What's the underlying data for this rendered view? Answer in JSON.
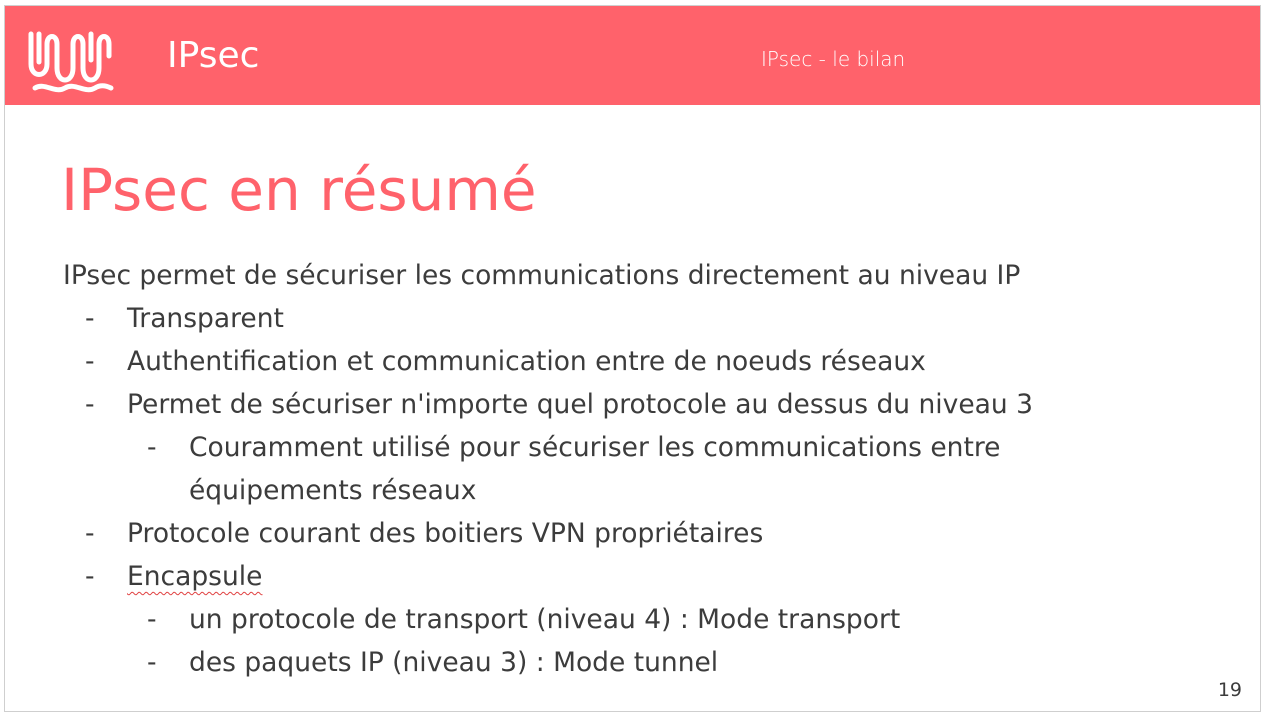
{
  "header": {
    "title": "IPsec",
    "section": "IPsec - le bilan"
  },
  "slide": {
    "title": "IPsec en résumé",
    "intro": "IPsec permet de sécuriser les communications directement au niveau IP",
    "bullets": [
      {
        "level": 1,
        "text": "Transparent"
      },
      {
        "level": 1,
        "text": "Authentification et communication entre de noeuds réseaux"
      },
      {
        "level": 1,
        "text": "Permet de sécuriser n'importe quel protocole au dessus du niveau 3"
      },
      {
        "level": 2,
        "lines": [
          "Couramment utilisé pour sécuriser les communications entre",
          "équipements réseaux"
        ]
      },
      {
        "level": 1,
        "text": "Protocole courant des boitiers VPN propriétaires"
      },
      {
        "level": 1,
        "text": "Encapsule"
      },
      {
        "level": 2,
        "text": "un protocole de transport (niveau 4) : Mode transport"
      },
      {
        "level": 2,
        "text": "des paquets IP (niveau 3) : Mode tunnel"
      }
    ],
    "bullet_marker": "-",
    "page_number": "19"
  },
  "colors": {
    "accent": "#ff626b",
    "text": "#3c3c3c",
    "header_text": "#ffffff"
  },
  "icons": {
    "logo": "wavy-loops-logo-icon"
  }
}
